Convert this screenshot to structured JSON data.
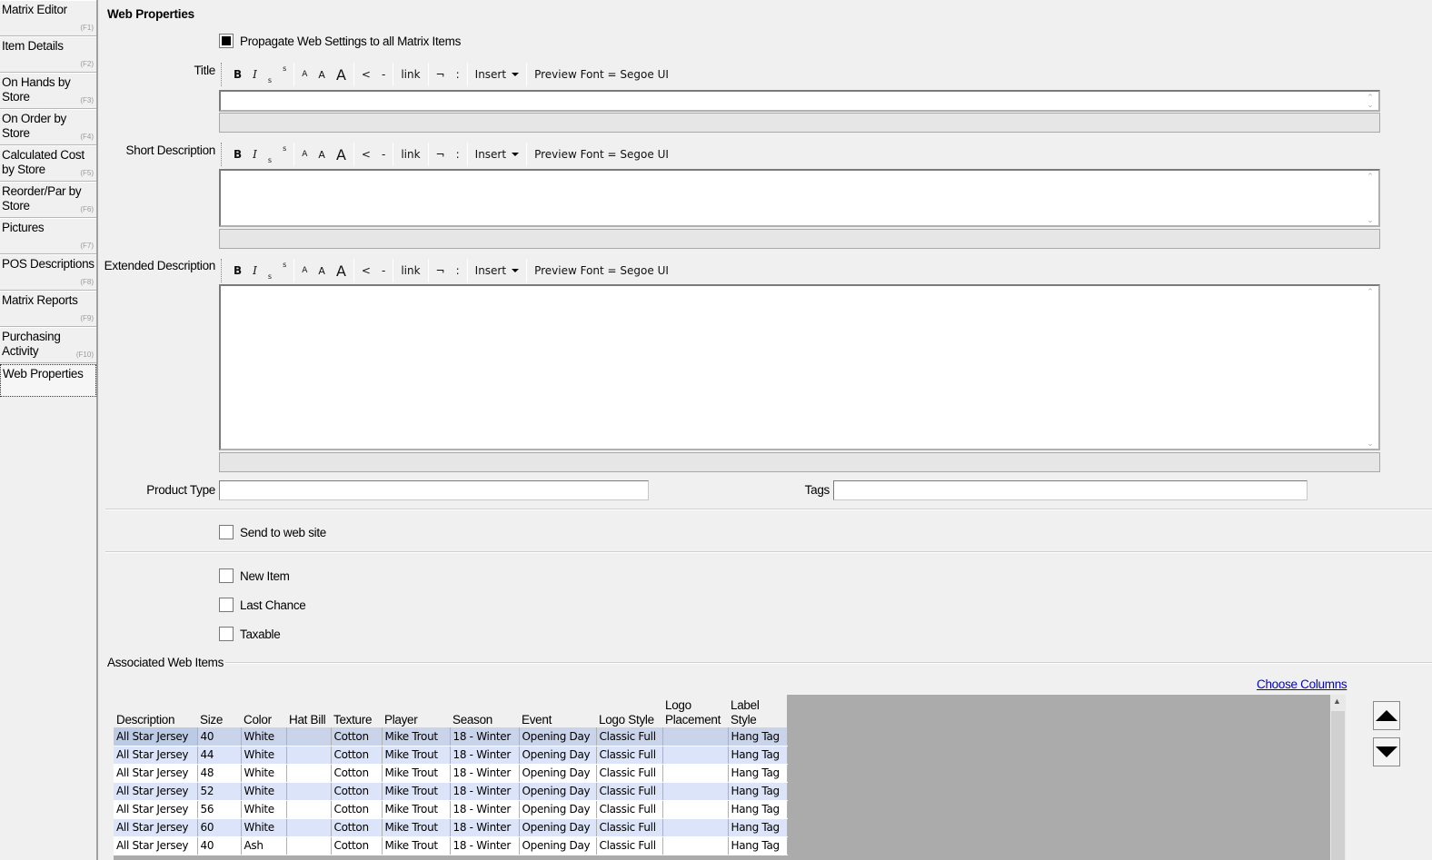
{
  "sidebar": {
    "items": [
      {
        "label": "Matrix Editor",
        "key": "(F1)"
      },
      {
        "label": "Item Details",
        "key": "(F2)"
      },
      {
        "label": "On Hands by Store",
        "key": "(F3)"
      },
      {
        "label": "On Order by Store",
        "key": "(F4)"
      },
      {
        "label": "Calculated Cost by Store",
        "key": "(F5)"
      },
      {
        "label": "Reorder/Par by Store",
        "key": "(F6)"
      },
      {
        "label": "Pictures",
        "key": "(F7)"
      },
      {
        "label": "POS Descriptions",
        "key": "(F8)"
      },
      {
        "label": "Matrix Reports",
        "key": "(F9)"
      },
      {
        "label": "Purchasing Activity",
        "key": "(F10)"
      },
      {
        "label": "Web Properties",
        "key": ""
      }
    ]
  },
  "page": {
    "title": "Web Properties",
    "propagate_label": "Propagate Web Settings to all Matrix Items"
  },
  "toolbar": {
    "bold": "B",
    "italic": "I",
    "subscript": "s",
    "superscript": "s",
    "font_small": "A",
    "font_medium": "A",
    "font_large": "A",
    "outdent": "<",
    "dash": "-",
    "link": "link",
    "not": "¬",
    "colon": ":",
    "insert": "Insert",
    "preview_font": "Preview Font = Segoe UI"
  },
  "fields": {
    "title_label": "Title",
    "short_desc_label": "Short Description",
    "extended_desc_label": "Extended Description",
    "product_type_label": "Product Type",
    "product_type_value": "",
    "tags_label": "Tags",
    "tags_value": ""
  },
  "checkboxes": {
    "send_to_web": "Send to web site",
    "new_item": "New Item",
    "last_chance": "Last Chance",
    "taxable": "Taxable"
  },
  "associated": {
    "title": "Associated Web Items",
    "choose_columns": "Choose Columns",
    "columns": [
      "Description",
      "Size",
      "Color",
      "Hat Bill",
      "Texture",
      "Player",
      "Season",
      "Event",
      "Logo Style",
      "Logo Placement",
      "Label Style"
    ],
    "rows": [
      [
        "All Star Jersey",
        "40",
        "White",
        "",
        "Cotton",
        "Mike Trout",
        "18 - Winter",
        "Opening Day",
        "Classic Full",
        "",
        "Hang Tag"
      ],
      [
        "All Star Jersey",
        "44",
        "White",
        "",
        "Cotton",
        "Mike Trout",
        "18 - Winter",
        "Opening Day",
        "Classic Full",
        "",
        "Hang Tag"
      ],
      [
        "All Star Jersey",
        "48",
        "White",
        "",
        "Cotton",
        "Mike Trout",
        "18 - Winter",
        "Opening Day",
        "Classic Full",
        "",
        "Hang Tag"
      ],
      [
        "All Star Jersey",
        "52",
        "White",
        "",
        "Cotton",
        "Mike Trout",
        "18 - Winter",
        "Opening Day",
        "Classic Full",
        "",
        "Hang Tag"
      ],
      [
        "All Star Jersey",
        "56",
        "White",
        "",
        "Cotton",
        "Mike Trout",
        "18 - Winter",
        "Opening Day",
        "Classic Full",
        "",
        "Hang Tag"
      ],
      [
        "All Star Jersey",
        "60",
        "White",
        "",
        "Cotton",
        "Mike Trout",
        "18 - Winter",
        "Opening Day",
        "Classic Full",
        "",
        "Hang Tag"
      ],
      [
        "All Star Jersey",
        "40",
        "Ash",
        "",
        "Cotton",
        "Mike Trout",
        "18 - Winter",
        "Opening Day",
        "Classic Full",
        "",
        "Hang Tag"
      ]
    ]
  },
  "colors": {
    "row_alt": "#dce4fa",
    "row_selected": "#c9d3ea",
    "link": "#0000cc",
    "grid_bg": "#ababab"
  }
}
